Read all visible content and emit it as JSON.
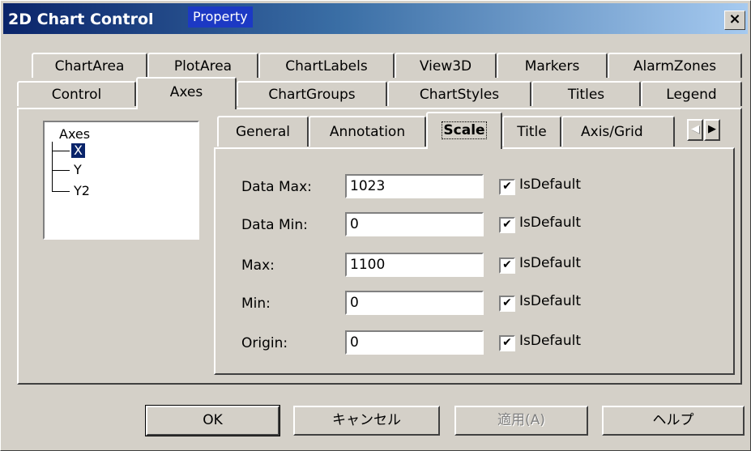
{
  "window": {
    "title": "2D Chart Control",
    "overlay_title": "Property",
    "close_symbol": "×"
  },
  "tabs_row1": [
    {
      "label": "ChartArea"
    },
    {
      "label": "PlotArea"
    },
    {
      "label": "ChartLabels"
    },
    {
      "label": "View3D"
    },
    {
      "label": "Markers"
    },
    {
      "label": "AlarmZones"
    }
  ],
  "tabs_row2": [
    {
      "label": "Control"
    },
    {
      "label": "Axes"
    },
    {
      "label": "ChartGroups"
    },
    {
      "label": "ChartStyles"
    },
    {
      "label": "Titles"
    },
    {
      "label": "Legend"
    }
  ],
  "active_tab": "Axes",
  "tree": {
    "root": "Axes",
    "items": [
      "X",
      "Y",
      "Y2"
    ],
    "selected": "X"
  },
  "subtabs": [
    {
      "label": "General"
    },
    {
      "label": "Annotation"
    },
    {
      "label": "Scale"
    },
    {
      "label": "Title"
    },
    {
      "label": "Axis/Grid"
    }
  ],
  "active_subtab": "Scale",
  "scroll": {
    "left_icon": "◀",
    "right_icon": "▶"
  },
  "fields": [
    {
      "label": "Data Max:",
      "value": "1023",
      "checked": true,
      "check_label": "IsDefault"
    },
    {
      "label": "Data Min:",
      "value": "0",
      "checked": true,
      "check_label": "IsDefault"
    },
    {
      "label": "Max:",
      "value": "1100",
      "checked": true,
      "check_label": "IsDefault"
    },
    {
      "label": "Min:",
      "value": "0",
      "checked": true,
      "check_label": "IsDefault"
    },
    {
      "label": "Origin:",
      "value": "0",
      "checked": true,
      "check_label": "IsDefault"
    }
  ],
  "buttons": {
    "ok": "OK",
    "cancel": "キャンセル",
    "apply": "適用(A)",
    "help": "ヘルプ"
  }
}
